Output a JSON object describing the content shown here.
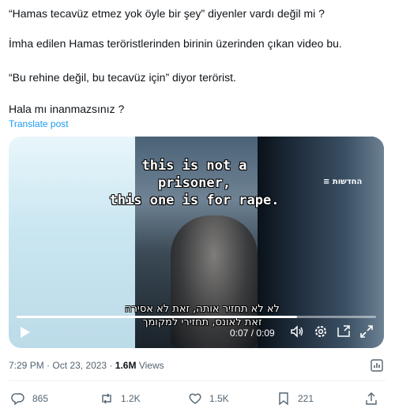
{
  "post": {
    "line1": "“Hamas tecavüz etmez yok öyle bir şey” diyenler vardı değil mi ?",
    "line2": "İmha edilen Hamas teröristlerinden birinin üzerinden çıkan video bu.",
    "line3": "“Bu rehine değil, bu tecavüz için” diyor terörist.",
    "line4": "Hala mı inanmazsınız ?",
    "translate_label": "Translate post"
  },
  "video": {
    "subtitle_en_line1": "this is not a prisoner,",
    "subtitle_en_line2": "this one is for rape.",
    "channel_logo": "החדשות ≡",
    "subtitle_he_line1": "לא לא תחזיר אותה, זאת לא אסירה",
    "subtitle_he_line2": "זאת לאונס, תחזירי למקומך",
    "time_display": "0:07 / 0:09",
    "progress_fraction": 0.78,
    "controls": {
      "play_icon": "play-icon",
      "volume_icon": "volume-icon",
      "settings_icon": "settings-icon",
      "pip_icon": "pip-icon",
      "fullscreen_icon": "fullscreen-icon"
    }
  },
  "meta": {
    "time": "7:29 PM",
    "separator": "·",
    "date": "Oct 23, 2023",
    "views_count": "1.6M",
    "views_label": "Views"
  },
  "actions": {
    "replies": "865",
    "reposts": "1.2K",
    "likes": "1.5K",
    "bookmarks": "221"
  },
  "colors": {
    "link": "#1d9bf0",
    "text": "#0f1419",
    "muted": "#536471"
  }
}
